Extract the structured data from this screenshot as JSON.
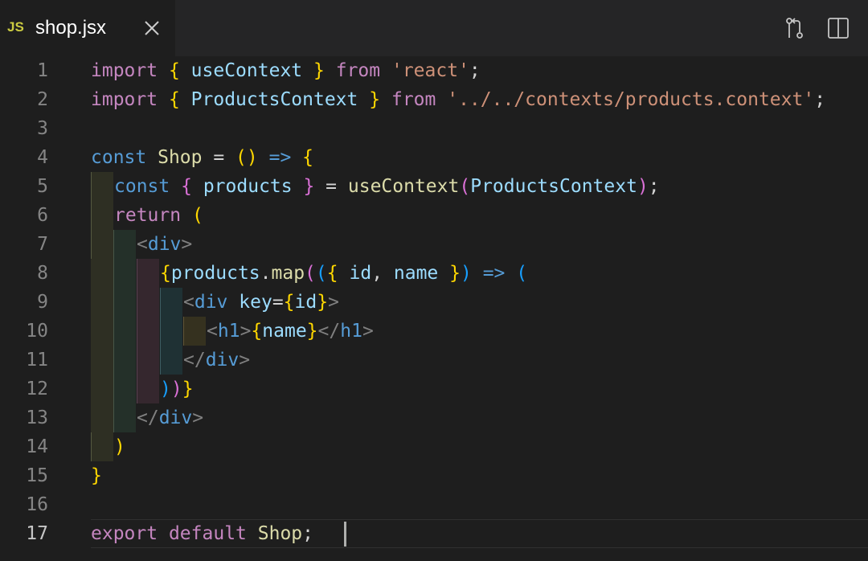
{
  "tab": {
    "badge": "JS",
    "title": "shop.jsx",
    "close_icon": "close-icon"
  },
  "actions": [
    {
      "icon": "compare-changes-icon"
    },
    {
      "icon": "split-editor-icon"
    }
  ],
  "colors": {
    "background": "#1e1e1e",
    "tabbar": "#252526",
    "keyword_import": "#c586c0",
    "keyword_storage": "#569cd6",
    "variable": "#9cdcfe",
    "string": "#ce9178",
    "function": "#dcdcaa",
    "class": "#4ec9b0",
    "bracket_gold": "#ffd700",
    "bracket_orchid": "#da70d6",
    "bracket_blue": "#179fff"
  },
  "editor": {
    "active_line": "17",
    "lines": [
      {
        "n": "1",
        "t": [
          "import",
          " ",
          "{",
          " ",
          "useContext",
          " ",
          "}",
          " ",
          "from",
          " ",
          "'react'",
          ";"
        ]
      },
      {
        "n": "2",
        "t": [
          "import",
          " ",
          "{",
          " ",
          "ProductsContext",
          " ",
          "}",
          " ",
          "from",
          " ",
          "'../../contexts/products.context'",
          ";"
        ]
      },
      {
        "n": "3",
        "t": []
      },
      {
        "n": "4",
        "t": [
          "const",
          " ",
          "Shop",
          " = ",
          "()",
          " => ",
          "{"
        ]
      },
      {
        "n": "5",
        "t": [
          "const",
          " ",
          "{",
          " ",
          "products",
          " ",
          "}",
          " = ",
          "useContext",
          "(",
          "ProductsContext",
          ")",
          ";"
        ]
      },
      {
        "n": "6",
        "t": [
          "return",
          " ",
          "("
        ]
      },
      {
        "n": "7",
        "t": [
          "<",
          "div",
          ">"
        ]
      },
      {
        "n": "8",
        "t": [
          "{",
          "products",
          ".",
          "map",
          "(",
          "(",
          "{",
          " ",
          "id",
          ", ",
          "name",
          " ",
          "}",
          ")",
          " => ",
          "("
        ]
      },
      {
        "n": "9",
        "t": [
          "<",
          "div",
          " ",
          "key",
          "=",
          "{",
          "id",
          "}",
          ">"
        ]
      },
      {
        "n": "10",
        "t": [
          "<",
          "h1",
          ">",
          "{",
          "name",
          "}",
          "</",
          "h1",
          ">"
        ]
      },
      {
        "n": "11",
        "t": [
          "</",
          "div",
          ">"
        ]
      },
      {
        "n": "12",
        "t": [
          ")",
          ")",
          "}"
        ]
      },
      {
        "n": "13",
        "t": [
          "</",
          "div",
          ">"
        ]
      },
      {
        "n": "14",
        "t": [
          ")"
        ]
      },
      {
        "n": "15",
        "t": [
          "}"
        ]
      },
      {
        "n": "16",
        "t": []
      },
      {
        "n": "17",
        "t": [
          "export",
          " ",
          "default",
          " ",
          "Shop",
          ";"
        ]
      }
    ]
  }
}
